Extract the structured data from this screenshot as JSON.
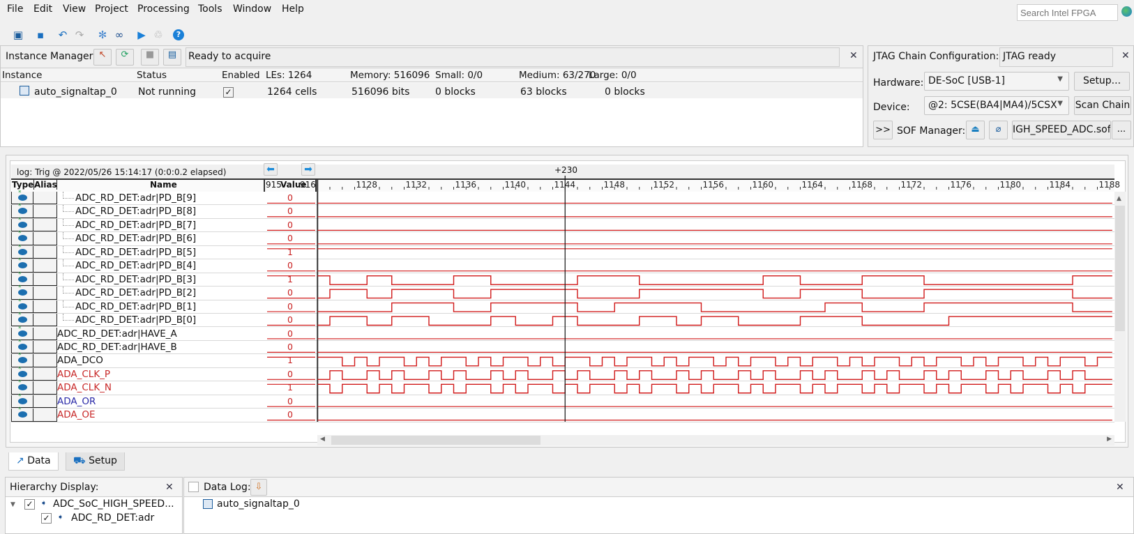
{
  "menu": [
    "File",
    "Edit",
    "View",
    "Project",
    "Processing",
    "Tools",
    "Window",
    "Help"
  ],
  "search": {
    "placeholder": "Search Intel FPGA"
  },
  "toolbar": [
    "window-icon",
    "save-icon",
    "undo-icon",
    "redo-icon",
    "snowflake-icon",
    "binoculars-icon",
    "run-icon",
    "recycle-icon",
    "help-icon"
  ],
  "instance_manager": {
    "label": "Instance Manager:",
    "status": "Ready to acquire",
    "columns": [
      "Instance",
      "Status",
      "Enabled",
      "LEs: 1264",
      "Memory: 516096",
      "Small: 0/0",
      "Medium: 63/270",
      "Large: 0/0"
    ],
    "row": {
      "instance": "auto_signaltap_0",
      "status": "Not running",
      "enabled": "✓",
      "les": "1264 cells",
      "memory": "516096 bits",
      "small": "0 blocks",
      "medium": "63 blocks",
      "large": "0 blocks"
    }
  },
  "jtag": {
    "label": "JTAG Chain Configuration:",
    "status": "JTAG ready",
    "hardware_label": "Hardware:",
    "hardware": "DE-SoC [USB-1]",
    "setup": "Setup...",
    "device_label": "Device:",
    "device": "@2: 5CSE(BA4|MA4)/5CSX",
    "scan": "Scan Chain",
    "expand": ">>",
    "sof_label": "SOF Manager:",
    "sof_file": "IGH_SPEED_ADC.sof",
    "browse": "..."
  },
  "waveform": {
    "log": "log: Trig @ 2022/05/26 15:14:17 (0:0:0.2 elapsed)",
    "marker_label": "+230",
    "marker_sample": 1145,
    "headers": {
      "type": "Type",
      "alias": "Alias",
      "name": "Name",
      "value": "Value",
      "value_left": "915",
      "value_right": "916"
    },
    "axis": {
      "start": 1125,
      "end": 1189.2,
      "labels": [
        1128,
        1132,
        1136,
        1140,
        1144,
        1148,
        1152,
        1156,
        1160,
        1164,
        1168,
        1172,
        1176,
        1180,
        1184,
        1188
      ]
    },
    "color": "#d01818",
    "signals": [
      {
        "name": "ADC_RD_DET:adr|PD_B[9]",
        "value": "0",
        "initial": 0,
        "toggles": [],
        "child": true,
        "color": "#111111"
      },
      {
        "name": "ADC_RD_DET:adr|PD_B[8]",
        "value": "0",
        "initial": 0,
        "toggles": [],
        "child": true,
        "color": "#111111"
      },
      {
        "name": "ADC_RD_DET:adr|PD_B[7]",
        "value": "0",
        "initial": 0,
        "toggles": [],
        "child": true,
        "color": "#111111"
      },
      {
        "name": "ADC_RD_DET:adr|PD_B[6]",
        "value": "0",
        "initial": 0,
        "toggles": [],
        "child": true,
        "color": "#111111"
      },
      {
        "name": "ADC_RD_DET:adr|PD_B[5]",
        "value": "1",
        "initial": 1,
        "toggles": [],
        "child": true,
        "color": "#111111"
      },
      {
        "name": "ADC_RD_DET:adr|PD_B[4]",
        "value": "0",
        "initial": 0,
        "toggles": [],
        "child": true,
        "color": "#111111"
      },
      {
        "name": "ADC_RD_DET:adr|PD_B[3]",
        "value": "1",
        "initial": 1,
        "toggles": [
          1126,
          1129,
          1131,
          1136,
          1139,
          1146,
          1151,
          1161,
          1164,
          1169,
          1174,
          1186
        ],
        "child": true,
        "color": "#111111"
      },
      {
        "name": "ADC_RD_DET:adr|PD_B[2]",
        "value": "0",
        "initial": 0,
        "toggles": [
          1126,
          1129,
          1131,
          1136,
          1139,
          1146,
          1151,
          1161,
          1164,
          1169,
          1174,
          1186
        ],
        "child": true,
        "color": "#111111"
      },
      {
        "name": "ADC_RD_DET:adr|PD_B[1]",
        "value": "0",
        "initial": 0,
        "toggles": [
          1131,
          1136,
          1139,
          1146,
          1149,
          1156,
          1166,
          1169,
          1174,
          1186
        ],
        "child": true,
        "color": "#111111"
      },
      {
        "name": "ADC_RD_DET:adr|PD_B[0]",
        "value": "0",
        "initial": 0,
        "toggles": [
          1126,
          1129,
          1131,
          1134,
          1139,
          1141,
          1144,
          1146,
          1151,
          1154,
          1156,
          1159,
          1164,
          1169,
          1176
        ],
        "child": true,
        "color": "#111111"
      },
      {
        "name": "ADC_RD_DET:adr|HAVE_A",
        "value": "0",
        "initial": 0,
        "toggles": [],
        "child": false,
        "color": "#111111"
      },
      {
        "name": "ADC_RD_DET:adr|HAVE_B",
        "value": "0",
        "initial": 0,
        "toggles": [],
        "child": false,
        "color": "#111111"
      },
      {
        "name": "ADA_DCO",
        "value": "1",
        "initial": 1,
        "toggles": [
          1127,
          1128,
          1129,
          1130,
          1132,
          1133,
          1134,
          1135,
          1137,
          1138,
          1139,
          1140,
          1142,
          1143,
          1144,
          1145,
          1147,
          1148,
          1149,
          1150,
          1152,
          1153,
          1154,
          1155,
          1157,
          1158,
          1159,
          1160,
          1162,
          1163,
          1164,
          1165,
          1167,
          1168,
          1169,
          1170,
          1172,
          1173,
          1174,
          1175,
          1177,
          1178,
          1179,
          1180,
          1182,
          1183,
          1184,
          1185,
          1187,
          1188
        ],
        "child": false,
        "color": "#111111"
      },
      {
        "name": "ADA_CLK_P",
        "value": "0",
        "initial": 0,
        "toggles": [
          1126,
          1127,
          1129,
          1130,
          1131,
          1132,
          1134,
          1135,
          1136,
          1137,
          1139,
          1140,
          1141,
          1142,
          1144,
          1145,
          1146,
          1147,
          1149,
          1150,
          1151,
          1152,
          1154,
          1155,
          1156,
          1157,
          1159,
          1160,
          1161,
          1162,
          1164,
          1165,
          1166,
          1167,
          1169,
          1170,
          1171,
          1172,
          1174,
          1175,
          1176,
          1177,
          1179,
          1180,
          1181,
          1182,
          1184,
          1185,
          1186,
          1187
        ],
        "child": false,
        "color": "#c82828"
      },
      {
        "name": "ADA_CLK_N",
        "value": "1",
        "initial": 1,
        "toggles": [
          1126,
          1127,
          1129,
          1130,
          1131,
          1132,
          1134,
          1135,
          1136,
          1137,
          1139,
          1140,
          1141,
          1142,
          1144,
          1145,
          1146,
          1147,
          1149,
          1150,
          1151,
          1152,
          1154,
          1155,
          1156,
          1157,
          1159,
          1160,
          1161,
          1162,
          1164,
          1165,
          1166,
          1167,
          1169,
          1170,
          1171,
          1172,
          1174,
          1175,
          1176,
          1177,
          1179,
          1180,
          1181,
          1182,
          1184,
          1185,
          1186,
          1187
        ],
        "child": false,
        "color": "#c82828"
      },
      {
        "name": "ADA_OR",
        "value": "0",
        "initial": 0,
        "toggles": [],
        "child": false,
        "color": "#2a2aa8"
      },
      {
        "name": "ADA_OE",
        "value": "0",
        "initial": 0,
        "toggles": [],
        "child": false,
        "color": "#c82828"
      }
    ]
  },
  "tabs": [
    {
      "label": "Data",
      "icon": "data-icon"
    },
    {
      "label": "Setup",
      "icon": "setup-icon"
    }
  ],
  "hierarchy": {
    "label": "Hierarchy Display:",
    "items": [
      {
        "label": "ADC_SoC_HIGH_SPEED...",
        "checked": "✓"
      },
      {
        "label": "ADC_RD_DET:adr",
        "checked": "✓"
      }
    ]
  },
  "datalog": {
    "label": "Data Log:",
    "item": "auto_signaltap_0"
  }
}
